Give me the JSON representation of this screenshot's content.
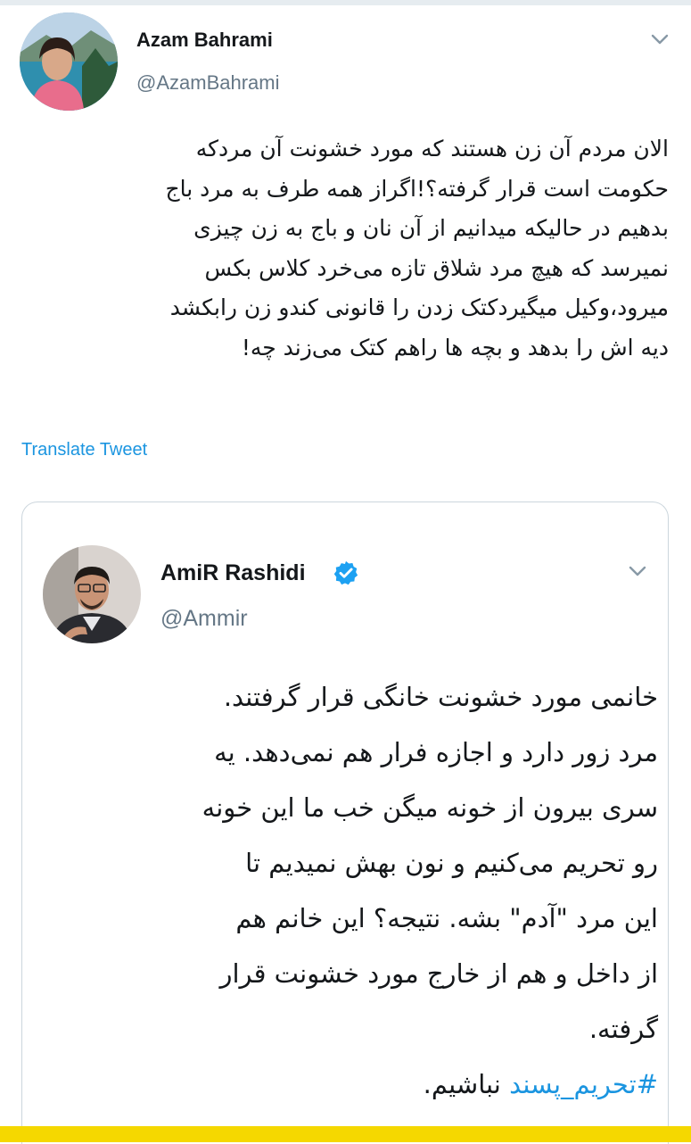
{
  "main_tweet": {
    "author_name": "Azam Bahrami",
    "author_handle": "@AzamBahrami",
    "lines": [
      "الان مردم آن زن هستند که مورد خشونت آن مردکه",
      "حکومت است قرار گرفته؟!اگراز همه طرف به مرد باج",
      "بدهیم در حالیکه میدانیم از آن نان و باج به زن چیزی",
      "نمیرسد که هیچ مرد شلاق تازه می‌خرد کلاس بکس",
      "میرود،وکیل میگیردکتک زدن را قانونی کندو زن رابکشد",
      "دیه اش را بدهد و بچه ها راهم کتک می‌زند چه!"
    ],
    "translate_label": "Translate Tweet"
  },
  "quoted_tweet": {
    "author_name": "AmiR Rashidi",
    "author_handle": "@Ammir",
    "verified": true,
    "lines": [
      "خانمی مورد خشونت خانگی قرار گرفتند.",
      "مرد زور دارد و اجازه فرار هم نمی‌دهد. یه",
      "سری بیرون از خونه میگن خب ما این خونه",
      "رو تحریم می‌کنیم و نون بهش نمیدیم تا",
      "این مرد \"آدم\" بشه. نتیجه؟ این خانم هم",
      "از داخل و هم از خارج مورد خشونت قرار",
      "گرفته."
    ],
    "last_line_hashtag": "#تحریم_پسند",
    "last_line_rest": " نباشیم."
  },
  "icons": {
    "menu": "chevron-down-icon",
    "verified": "verified-badge-icon"
  },
  "colors": {
    "link_blue": "#1b95e0",
    "verified_blue": "#1da1f2",
    "muted": "#657786",
    "highlight_bar": "#f5d800"
  }
}
